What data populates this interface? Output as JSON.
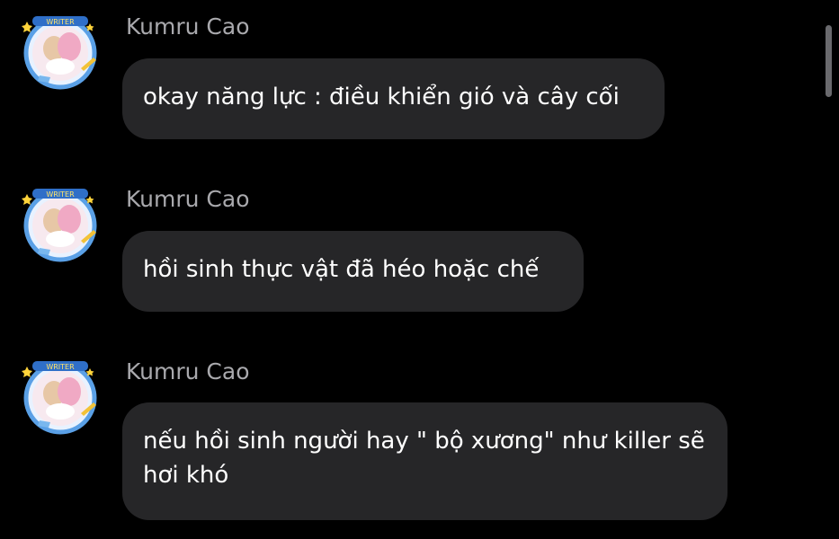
{
  "messages": [
    {
      "sender": "Kumru Cao",
      "text": "okay năng lực : điều khiển gió và cây cối",
      "avatar_badge": "WRITER"
    },
    {
      "sender": "Kumru Cao",
      "text": "hồi sinh thực vật đã héo hoặc chế",
      "avatar_badge": "WRITER"
    },
    {
      "sender": "Kumru Cao",
      "text": "nếu hồi sinh người hay \" bộ xương\" như killer sẽ hơi khó",
      "avatar_badge": "WRITER"
    }
  ],
  "colors": {
    "background": "#000000",
    "bubble": "#262628",
    "sender_text": "#a9a9ad",
    "message_text": "#ffffff"
  }
}
